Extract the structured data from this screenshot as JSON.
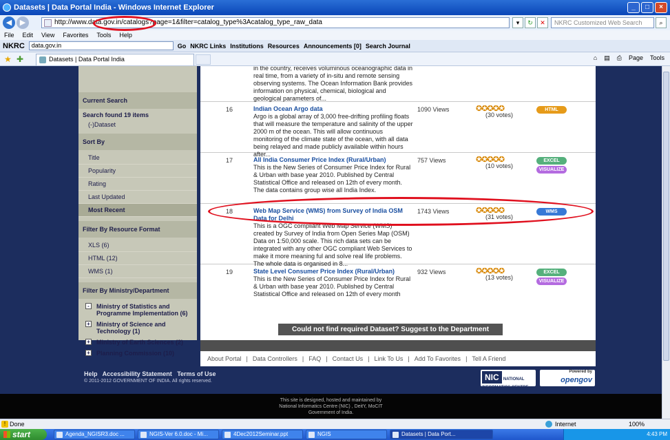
{
  "window": {
    "title": "Datasets | Data Portal India - Windows Internet Explorer"
  },
  "address": {
    "url": "http://www.data.gov.in/catalogs?page=1&filter=catalog_type%3Acatalog_type_raw_data",
    "search_placeholder": "NKRC Customized Web Search"
  },
  "menu": [
    "File",
    "Edit",
    "View",
    "Favorites",
    "Tools",
    "Help"
  ],
  "nkrc_toolbar": {
    "logo": "NKRC",
    "combo": "data.gov.in",
    "go": "Go",
    "items": [
      "NKRC Links",
      "Institutions",
      "Resources",
      "Announcements [0]",
      "Search Journal"
    ]
  },
  "tab": {
    "title": "Datasets | Data Portal India"
  },
  "command_bar": [
    "Page",
    "Tools"
  ],
  "sidebar": {
    "current_search": "Current Search",
    "found": "Search found 19 items",
    "dataset_filter": "(-)Dataset",
    "sort_by": "Sort By",
    "sort_options": [
      "Title",
      "Popularity",
      "Rating",
      "Last Updated",
      "Most Recent"
    ],
    "active_sort": "Most Recent",
    "filter_format": "Filter By Resource Format",
    "formats": [
      "XLS (6)",
      "HTML (12)",
      "WMS (1)"
    ],
    "filter_ministry": "Filter By Ministry/Department",
    "ministries": [
      {
        "label": "Ministry of Statistics and Programme Implementation (6)",
        "toggle": "-"
      },
      {
        "label": "Ministry of Science and Technology (1)",
        "toggle": "+"
      },
      {
        "label": "Ministry of Earth Sciences (2)",
        "toggle": "+"
      },
      {
        "label": "Planning Commission (10)",
        "toggle": "+"
      }
    ]
  },
  "prev_desc": "in the country, receives voluminous oceanographic data in real time, from a variety of in-situ and remote sensing observing systems. The Ocean Information Bank provides information on physical, chemical, biological and geological parameters of...",
  "results": [
    {
      "num": "16",
      "title": "Indian Ocean Argo data",
      "desc": "Argo is a global array of 3,000 free-drifting profiling floats that will measure the temperature and salinity of the upper 2000 m of the ocean. This will allow continuous monitoring of the climate state of the ocean, with all data being relayed and made publicly available within hours after...",
      "views": "1090 Views",
      "votes": "(30 votes)",
      "badges": [
        "HTML"
      ]
    },
    {
      "num": "17",
      "title": "All India Consumer Price Index (Rural/Urban)",
      "desc": "This is the New Series of Consumer Price Index for Rural & Urban with base year 2010. Published by Central Statistical Office and released on 12th of every month. The data contains group wise all India Index.",
      "views": "757 Views",
      "votes": "(10 votes)",
      "badges": [
        "EXCEL",
        "VISUALIZE"
      ]
    },
    {
      "num": "18",
      "title": "Web Map Service (WMS) from Survey of India OSM Data for Delhi",
      "desc": "This is a OGC compliant Web Map Service (WMS) created by Survey of India from Open Series Map (OSM) Data on 1:50,000 scale. This rich data sets can be integrated with any other OGC compliant Web Services to make it more meaning ful and solve real life problems. The whole data is organised in 8...",
      "views": "1743 Views",
      "votes": "(31 votes)",
      "badges": [
        "WMS"
      ]
    },
    {
      "num": "19",
      "title": "State Level Consumer Price Index (Rural/Urban)",
      "desc": "This is the New Series of Consumer Price Index for Rural & Urban with base year 2010. Published by Central Statistical Office and released on 12th of every month",
      "views": "932 Views",
      "votes": "(13 votes)",
      "badges": [
        "EXCEL",
        "VISUALIZE"
      ]
    }
  ],
  "suggest": "Could not find required Dataset? Suggest to the Department",
  "footer_links": [
    "About Portal",
    "Data Controllers",
    "FAQ",
    "Contact Us",
    "Link To Us",
    "Add To Favorites",
    "Tell A Friend"
  ],
  "footer": {
    "help": "Help   Accessibility Statement   Terms of Use",
    "copy": "© 2011-2012 GOVERNMENT OF INDIA. All rights reserved.",
    "nic": "NIC",
    "nic_text": "NATIONAL INFORMATICS CENTRE",
    "opengov_small": "Powered by",
    "opengov": "opengov",
    "designed": "This site is designed, hosted and maintained by\nNational Informatics Centre (NIC) , DeitY, MoCIT\nGovernment of India."
  },
  "status": {
    "text": "Done",
    "zone": "Internet",
    "zoom": "100%"
  },
  "taskbar": {
    "start": "start",
    "tasks": [
      "Agenda_NGISR3.doc ...",
      "NGIS-Ver 6.0.doc - Mi...",
      "4Dec2012Seminar.ppt",
      "NGIS",
      "Datasets | Data Port..."
    ],
    "time": "4:43 PM"
  }
}
